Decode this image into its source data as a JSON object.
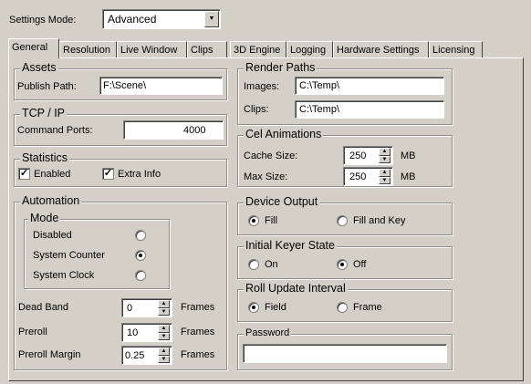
{
  "settings_mode": {
    "label": "Settings Mode:",
    "value": "Advanced"
  },
  "tabs": [
    "General",
    "Resolution",
    "Live Window",
    "Clips",
    "3D Engine",
    "Logging",
    "Hardware Settings",
    "Licensing"
  ],
  "assets": {
    "title": "Assets",
    "publish_label": "Publish Path:",
    "publish_value": "F:\\Scene\\"
  },
  "tcpip": {
    "title": "TCP / IP",
    "ports_label": "Command Ports:",
    "ports_value": "4000"
  },
  "statistics": {
    "title": "Statistics",
    "enabled_label": "Enabled",
    "enabled_checked": true,
    "extra_label": "Extra Info",
    "extra_checked": true
  },
  "automation": {
    "title": "Automation",
    "mode_title": "Mode",
    "disabled_label": "Disabled",
    "system_counter_label": "System Counter",
    "system_clock_label": "System Clock",
    "selected_mode": "System Counter",
    "dead_band_label": "Dead Band",
    "dead_band_value": "0",
    "preroll_label": "Preroll",
    "preroll_value": "10",
    "preroll_margin_label": "Preroll Margin",
    "preroll_margin_value": "0.25",
    "unit": "Frames"
  },
  "render_paths": {
    "title": "Render Paths",
    "images_label": "Images:",
    "images_value": "C:\\Temp\\",
    "clips_label": "Clips:",
    "clips_value": "C:\\Temp\\"
  },
  "cel_animations": {
    "title": "Cel Animations",
    "cache_label": "Cache Size:",
    "cache_value": "250",
    "max_label": "Max Size:",
    "max_value": "250",
    "unit": "MB"
  },
  "device_output": {
    "title": "Device Output",
    "fill_label": "Fill",
    "fill_key_label": "Fill and Key",
    "selected": "Fill"
  },
  "initial_keyer": {
    "title": "Initial Keyer State",
    "on_label": "On",
    "off_label": "Off",
    "selected": "Off"
  },
  "roll_update": {
    "title": "Roll Update Interval",
    "field_label": "Field",
    "frame_label": "Frame",
    "selected": "Field"
  },
  "password": {
    "title": "Password",
    "value": ""
  },
  "icons": {
    "combo_arrow": "▼",
    "spin_up": "▲",
    "spin_down": "▼",
    "check": "✓"
  }
}
